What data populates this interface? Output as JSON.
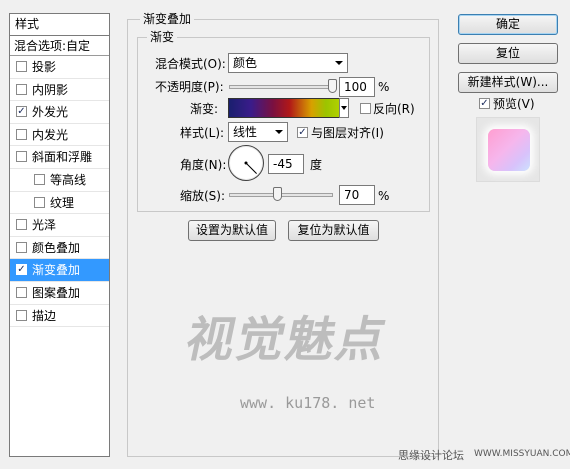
{
  "styles_panel": {
    "title": "样式",
    "blend_options": "混合选项:自定",
    "items": [
      {
        "label": "投影",
        "checked": false,
        "sub": false,
        "selected": false
      },
      {
        "label": "内阴影",
        "checked": false,
        "sub": false,
        "selected": false
      },
      {
        "label": "外发光",
        "checked": true,
        "sub": false,
        "selected": false
      },
      {
        "label": "内发光",
        "checked": false,
        "sub": false,
        "selected": false
      },
      {
        "label": "斜面和浮雕",
        "checked": false,
        "sub": false,
        "selected": false
      },
      {
        "label": "等高线",
        "checked": false,
        "sub": true,
        "selected": false
      },
      {
        "label": "纹理",
        "checked": false,
        "sub": true,
        "selected": false
      },
      {
        "label": "光泽",
        "checked": false,
        "sub": false,
        "selected": false
      },
      {
        "label": "颜色叠加",
        "checked": false,
        "sub": false,
        "selected": false
      },
      {
        "label": "渐变叠加",
        "checked": true,
        "sub": false,
        "selected": true
      },
      {
        "label": "图案叠加",
        "checked": false,
        "sub": false,
        "selected": false
      },
      {
        "label": "描边",
        "checked": false,
        "sub": false,
        "selected": false
      }
    ]
  },
  "gradient_overlay": {
    "group_title": "渐变叠加",
    "sub_group_title": "渐变",
    "blend_mode_label": "混合模式(O):",
    "blend_mode_value": "颜色",
    "opacity_label": "不透明度(P):",
    "opacity_value": "100",
    "opacity_unit": "%",
    "gradient_label": "渐变:",
    "reverse_label": "反向(R)",
    "reverse_checked": false,
    "style_label": "样式(L):",
    "style_value": "线性",
    "align_label": "与图层对齐(I)",
    "align_checked": true,
    "angle_label": "角度(N):",
    "angle_value": "-45",
    "angle_unit": "度",
    "scale_label": "缩放(S):",
    "scale_value": "70",
    "scale_unit": "%",
    "set_default": "设置为默认值",
    "reset_default": "复位为默认值"
  },
  "right_panel": {
    "ok": "确定",
    "reset": "复位",
    "new_style": "新建样式(W)...",
    "preview_label": "预览(V)",
    "preview_checked": true
  },
  "watermark": {
    "logo": "视觉魅点",
    "url": "www. ku178. net"
  },
  "footer": {
    "text": "思缘设计论坛",
    "site": "WWW.MISSYUAN.COM"
  },
  "colors": {
    "selection": "#3399ff",
    "panel_bg": "#f0f0f0"
  }
}
